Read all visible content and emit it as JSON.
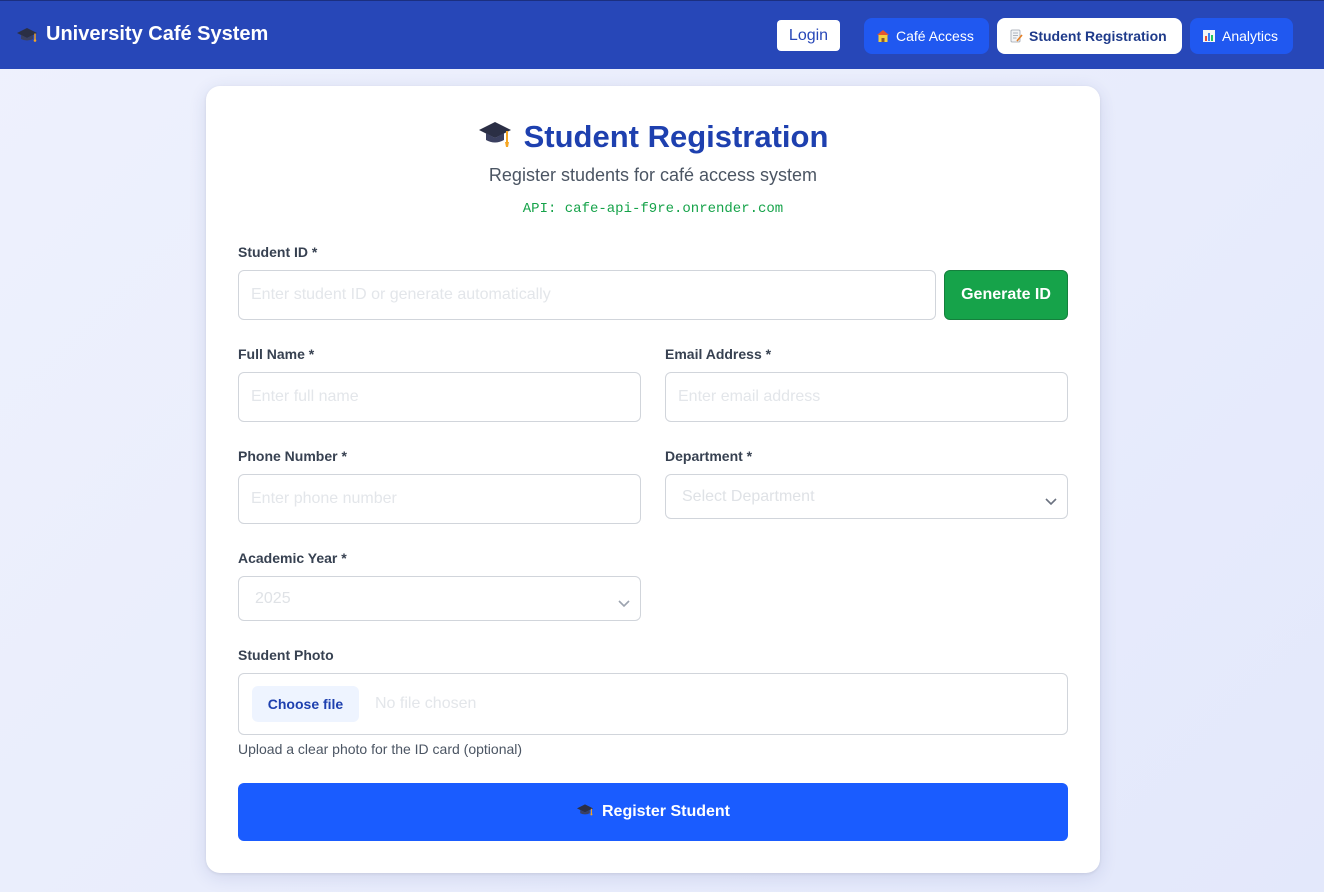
{
  "header": {
    "brand": "University Café System",
    "login_label": "Login",
    "nav": [
      {
        "label": "Café Access",
        "icon": "house-icon"
      },
      {
        "label": "Student Registration",
        "icon": "memo-icon",
        "active": true
      },
      {
        "label": "Analytics",
        "icon": "bar-chart-icon"
      }
    ]
  },
  "form": {
    "title": "Student Registration",
    "subtitle": "Register students for café access system",
    "api": "API: cafe-api-f9re.onrender.com",
    "student_id": {
      "label": "Student ID *",
      "placeholder": "Enter student ID or generate automatically"
    },
    "generate_label": "Generate ID",
    "full_name": {
      "label": "Full Name *",
      "placeholder": "Enter full name"
    },
    "email": {
      "label": "Email Address *",
      "placeholder": "Enter email address"
    },
    "phone": {
      "label": "Phone Number *",
      "placeholder": "Enter phone number"
    },
    "department": {
      "label": "Department *",
      "selected": "Select Department"
    },
    "academic_year": {
      "label": "Academic Year *",
      "selected": "2025"
    },
    "photo": {
      "label": "Student Photo",
      "choose_label": "Choose file",
      "status": "No file chosen",
      "hint": "Upload a clear photo for the ID card (optional)"
    },
    "submit_label": "Register Student"
  },
  "colors": {
    "header_bg": "#2747b8",
    "accent": "#1a5cff",
    "success": "#16a34a",
    "title": "#1e40af"
  }
}
